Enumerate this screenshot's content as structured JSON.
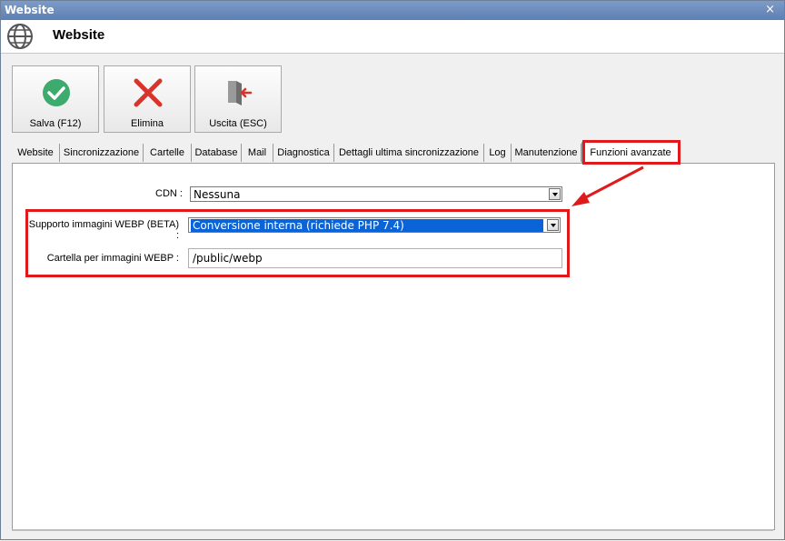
{
  "window": {
    "title": "Website",
    "close_glyph": "×"
  },
  "header": {
    "title": "Website",
    "icon": "globe-icon"
  },
  "toolbar": [
    {
      "label": "Salva (F12)",
      "icon": "checkmark-icon",
      "color": "#3daa6e"
    },
    {
      "label": "Elimina",
      "icon": "cross-icon",
      "color": "#d9342b"
    },
    {
      "label": "Uscita (ESC)",
      "icon": "exit-door-icon",
      "color": "#d9342b"
    }
  ],
  "tabs": [
    "Website",
    "Sincronizzazione",
    "Cartelle",
    "Database",
    "Mail",
    "Diagnostica",
    "Dettagli ultima sincronizzazione",
    "Log",
    "Manutenzione",
    "Funzioni avanzate"
  ],
  "active_tab": "Funzioni avanzate",
  "form": {
    "cdn": {
      "label": "CDN :",
      "value": "Nessuna"
    },
    "webp_support": {
      "label": "Supporto immagini WEBP (BETA) :",
      "value": "Conversione interna (richiede PHP 7.4)"
    },
    "webp_folder": {
      "label": "Cartella per immagini WEBP :",
      "value": "/public/webp"
    }
  },
  "highlight_color": "#e01a1a"
}
